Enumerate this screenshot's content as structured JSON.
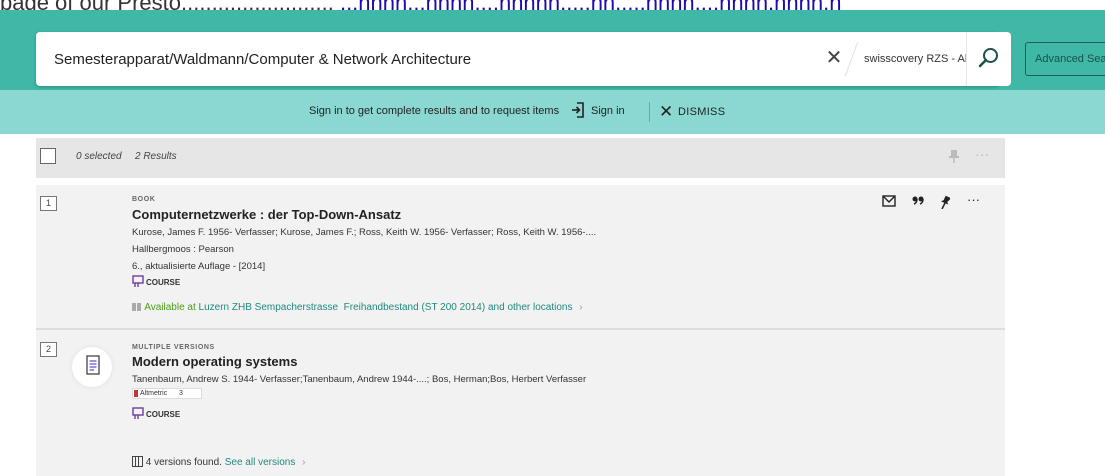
{
  "top_text": {
    "prefix": "page of our Presto.........................",
    "link": "...nnnn...nnnn....nnnnn.....nn.....nnnn....nnnn.nnnn.n"
  },
  "search": {
    "value": "Semesterapparat/Waldmann/Computer & Network Architecture",
    "scope_label": "swisscovery RZS - Alles",
    "advanced_label": "Advanced Search"
  },
  "signin_bar": {
    "message": "Sign in to get complete results and to request items",
    "signin_label": "Sign in",
    "dismiss_label": "DISMISS"
  },
  "results": {
    "selected_text": "0 selected",
    "count_text": "2 Results"
  },
  "records": [
    {
      "number": "1",
      "type": "BOOK",
      "title": "Computernetzwerke : der Top-Down-Ansatz",
      "authors": "Kurose, James F. 1956- Verfasser; Kurose, James F.; Ross, Keith W. 1956- Verfasser; Ross, Keith W. 1956-....",
      "publisher": "Hallbergmoos : Pearson",
      "edition": "6., aktualisierte Auflage - [2014]",
      "course_label": "COURSE",
      "availability": {
        "status": "Available at",
        "location": "Luzern ZHB Sempacherstrasse",
        "shelf": "Freihandbestand (ST 200 2014)",
        "suffix": "and other locations"
      }
    },
    {
      "number": "2",
      "type": "MULTIPLE VERSIONS",
      "title": "Modern operating systems",
      "authors": "Tanenbaum, Andrew S. 1944- Verfasser;Tanenbaum, Andrew 1944-....; Bos, Herman;Bos, Herbert Verfasser",
      "altmetric_label": "Altmetric",
      "altmetric_score": "3",
      "course_label": "COURSE",
      "versions_text": "4 versions found.",
      "see_all_label": "See all versions"
    }
  ],
  "colors": {
    "header": "#3fb8a8",
    "signin_bar": "#8bd8d2",
    "link": "#1f8a7e",
    "available": "#4a9d1a"
  }
}
